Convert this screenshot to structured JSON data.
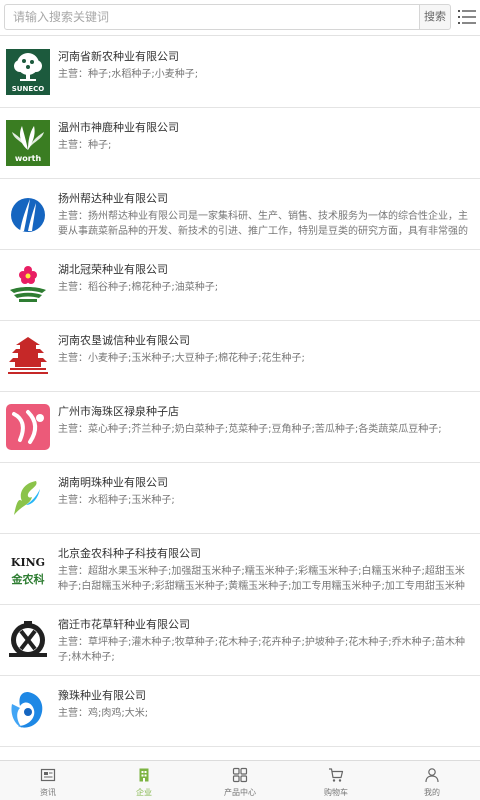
{
  "search": {
    "placeholder": "请输入搜索关键词",
    "button_label": "搜索"
  },
  "companies": [
    {
      "name": "河南省新农种业有限公司",
      "desc": "主营：种子;水稻种子;小麦种子;",
      "logo_icon": "suneco-tree-logo",
      "logo_text": "SUNECO"
    },
    {
      "name": "温州市神鹿种业有限公司",
      "desc": "主营：种子;",
      "logo_icon": "worth-leaf-logo",
      "logo_text": "worth"
    },
    {
      "name": "扬州帮达种业有限公司",
      "desc": "主营：扬州帮达种业有限公司是一家集科研、生产、销售、技术服务为一体的综合性企业，主要从事蔬菜新品种的开发、新技术的引进、推广工作，特别是豆类的研究方面，具有非常强的优势。",
      "logo_icon": "blue-wave-logo"
    },
    {
      "name": "湖北冠荣种业有限公司",
      "desc": "主营：稻谷种子;棉花种子;油菜种子;",
      "logo_icon": "flower-logo"
    },
    {
      "name": "河南农垦诚信种业有限公司",
      "desc": "主营：小麦种子;玉米种子;大豆种子;棉花种子;花生种子;",
      "logo_icon": "pagoda-logo"
    },
    {
      "name": "广州市海珠区禄泉种子店",
      "desc": "主营：菜心种子;芥兰种子;奶白菜种子;苋菜种子;豆角种子;苦瓜种子;各类蔬菜瓜豆种子;",
      "logo_icon": "pink-wave-logo"
    },
    {
      "name": "湖南明珠种业有限公司",
      "desc": "主营：水稻种子;玉米种子;",
      "logo_icon": "green-swirl-logo"
    },
    {
      "name": "北京金农科种子科技有限公司",
      "desc": "主营：超甜水果玉米种子;加强甜玉米种子;糯玉米种子;彩糯玉米种子;白糯玉米种子;超甜玉米种子;白甜糯玉米种子;彩甜糯玉米种子;黄糯玉米种子;加工专用糯玉米种子;加工专用甜玉米种子;",
      "logo_icon": "king-logo",
      "logo_text": "KING",
      "logo_subtext": "金农科"
    },
    {
      "name": "宿迁市花草轩种业有限公司",
      "desc": "主营：草坪种子;灌木种子;牧草种子;花木种子;花卉种子;护坡种子;花木种子;乔木种子;苗木种子;林木种子;",
      "logo_icon": "crest-logo"
    },
    {
      "name": "豫珠种业有限公司",
      "desc": "主营：鸡;肉鸡;大米;",
      "logo_icon": "blue-spiral-logo"
    }
  ],
  "tabbar": [
    {
      "label": "资讯",
      "icon": "news-icon"
    },
    {
      "label": "企业",
      "icon": "building-icon",
      "active": true
    },
    {
      "label": "产品中心",
      "icon": "grid-icon"
    },
    {
      "label": "购物车",
      "icon": "cart-icon"
    },
    {
      "label": "我的",
      "icon": "user-icon"
    }
  ],
  "colors": {
    "accent": "#7cb342",
    "border": "#e4e4e4",
    "text": "#333333",
    "muted": "#777777"
  }
}
